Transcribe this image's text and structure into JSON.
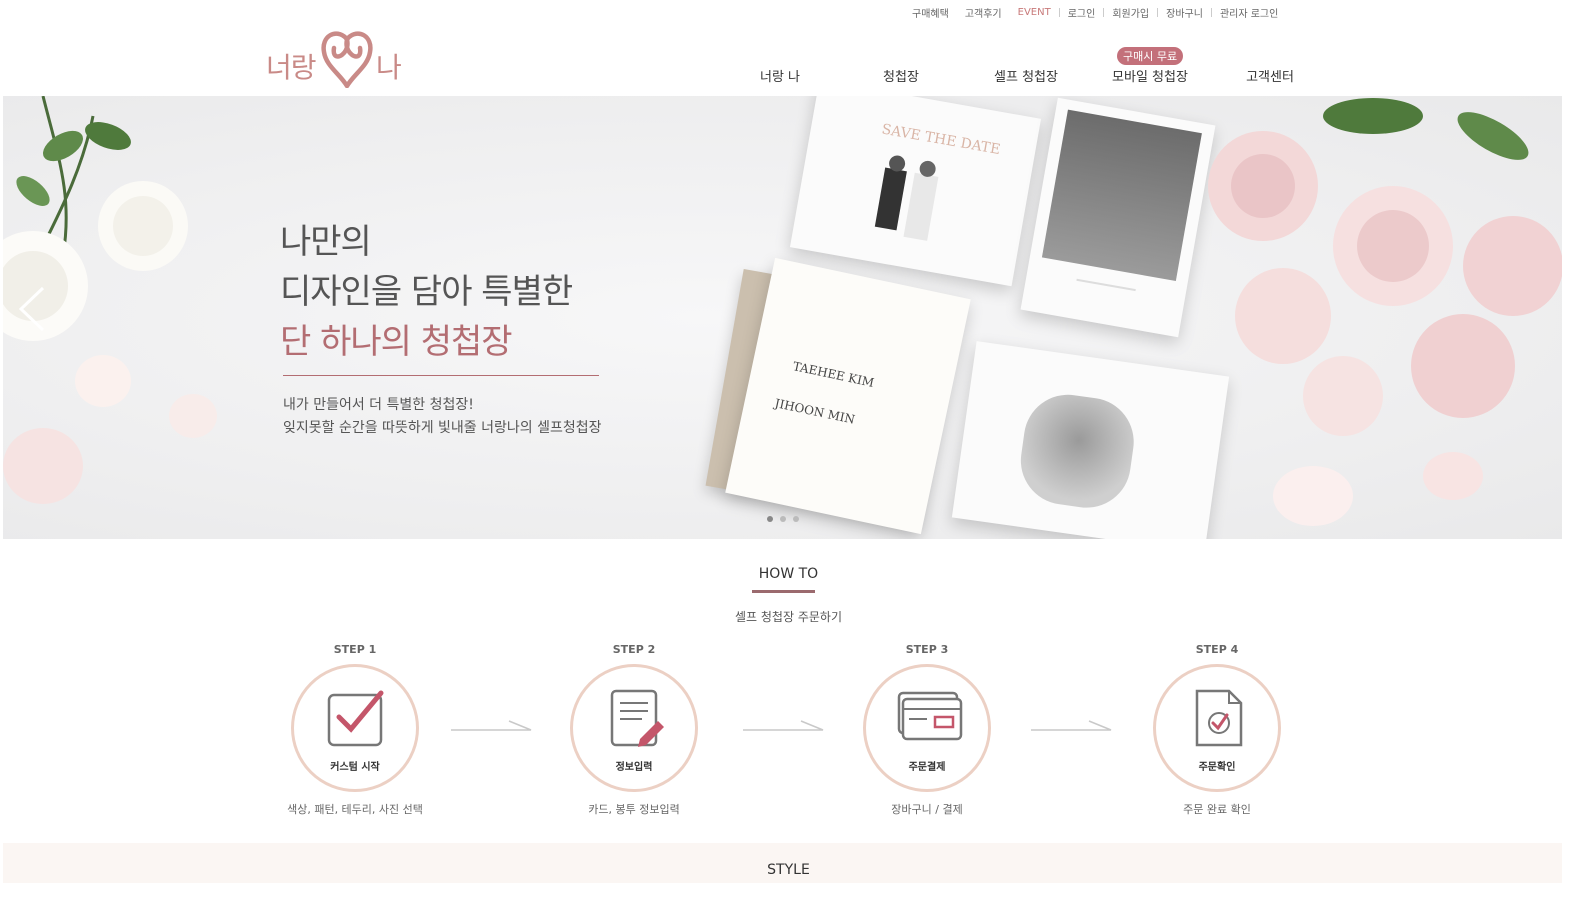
{
  "util_menu": [
    "구매혜택",
    "고객후기",
    "EVENT",
    "로그인",
    "회원가입",
    "장바구니",
    "관리자 로그인"
  ],
  "logo": {
    "left": "너랑",
    "right": "나"
  },
  "nav": {
    "items": [
      "너랑 나",
      "청첩장",
      "셀프 청첩장",
      "모바일 청첩장",
      "고객센터"
    ],
    "badge": "구매시 무료"
  },
  "hero": {
    "line1": "나만의",
    "line2": "디자인을 담아 특별한",
    "line3": "단 하나의 청첩장",
    "sub1": "내가 만들어서 더 특별한 청첩장!",
    "sub2": "잊지못할 순간을 따뜻하게 빛내줄 너랑나의 셀프청첩장",
    "slides_total": 3,
    "slide_current": 1,
    "card_texts": [
      "SAVE THE DATE",
      "TAEHEE KIM",
      "JIHOON MIN"
    ]
  },
  "howto": {
    "title": "HOW TO",
    "subtitle": "셀프 청첩장 주문하기",
    "steps": [
      {
        "step": "STEP 1",
        "name": "커스텀 시작",
        "desc": "색상, 패턴, 테두리, 사진 선택",
        "icon": "checkbox-icon"
      },
      {
        "step": "STEP 2",
        "name": "정보입력",
        "desc": "카드, 봉투 정보입력",
        "icon": "document-edit-icon"
      },
      {
        "step": "STEP 3",
        "name": "주문결제",
        "desc": "장바구니 / 결제",
        "icon": "credit-card-icon"
      },
      {
        "step": "STEP 4",
        "name": "주문확인",
        "desc": "주문 완료 확인",
        "icon": "order-check-icon"
      }
    ]
  },
  "style_section": {
    "title": "STYLE"
  },
  "colors": {
    "accent": "#b36d72",
    "badge": "#c3707a",
    "circle": "#ecd0c4",
    "event": "#c87979"
  }
}
